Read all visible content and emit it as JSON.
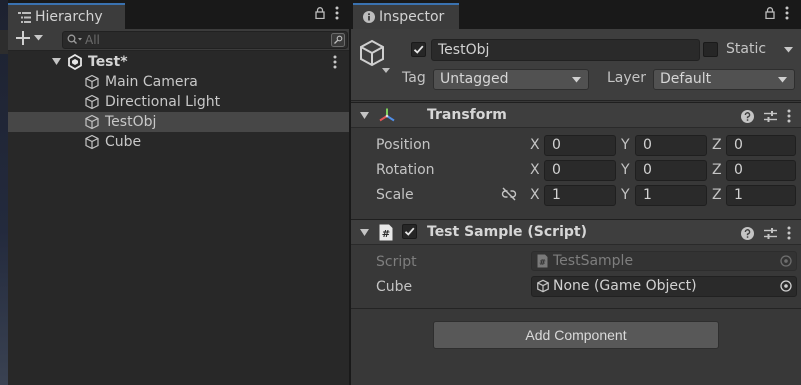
{
  "hierarchy": {
    "tab_title": "Hierarchy",
    "search": {
      "placeholder": "All",
      "value": ""
    },
    "scene": {
      "name": "Test*"
    },
    "items": [
      {
        "label": "Main Camera"
      },
      {
        "label": "Directional Light"
      },
      {
        "label": "TestObj",
        "selected": true
      },
      {
        "label": "Cube"
      }
    ]
  },
  "inspector": {
    "tab_title": "Inspector",
    "gameobject": {
      "active": true,
      "name": "TestObj",
      "static_label": "Static",
      "static": false,
      "tag_label": "Tag",
      "tag_value": "Untagged",
      "layer_label": "Layer",
      "layer_value": "Default"
    },
    "transform": {
      "title": "Transform",
      "position_label": "Position",
      "rotation_label": "Rotation",
      "scale_label": "Scale",
      "axes": {
        "x": "X",
        "y": "Y",
        "z": "Z"
      },
      "position": {
        "x": "0",
        "y": "0",
        "z": "0"
      },
      "rotation": {
        "x": "0",
        "y": "0",
        "z": "0"
      },
      "scale": {
        "x": "1",
        "y": "1",
        "z": "1"
      }
    },
    "script_component": {
      "title": "Test Sample (Script)",
      "enabled": true,
      "script_label": "Script",
      "script_value": "TestSample",
      "cube_label": "Cube",
      "cube_value": "None (Game Object)"
    },
    "add_component_label": "Add Component"
  },
  "colors": {
    "accent": "#3a72b0",
    "panel_bg": "#383838",
    "hierarchy_bg": "#282828",
    "selection": "#474747"
  }
}
